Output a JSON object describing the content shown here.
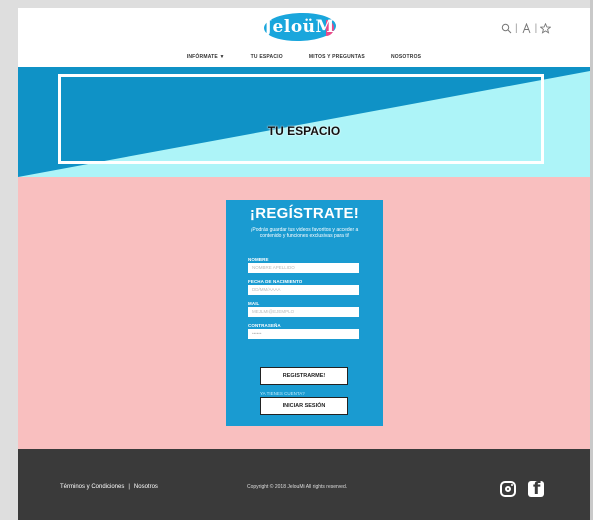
{
  "header": {
    "logo_text": "JeloüMi",
    "icons": [
      "search-icon",
      "user-icon",
      "star-icon"
    ],
    "separator": "|"
  },
  "nav": {
    "items": [
      {
        "label": "INFÓRMATE ▼"
      },
      {
        "label": "TU ESPACIO"
      },
      {
        "label": "MITOS Y PREGUNTAS"
      },
      {
        "label": "NOSOTROS"
      }
    ]
  },
  "banner": {
    "title": "TU ESPACIO",
    "colors": {
      "dark": "#0f92c6",
      "light": "#adf4f8"
    }
  },
  "form": {
    "title": "¡REGÍSTRATE!",
    "subtitle": "¡Podrás guardar tus videos favoritos y acceder a contenido y funciones exclusivas para ti!",
    "fields": [
      {
        "label": "NOMBRE",
        "placeholder": "NOMBRE APELLIDO"
      },
      {
        "label": "FECHA DE NACIMIENTO",
        "placeholder": "DD/MM/AAAA"
      },
      {
        "label": "MAIL",
        "placeholder": "MEJLMI@EJEMPLO"
      },
      {
        "label": "CONTRASEÑA",
        "placeholder": "••••••"
      }
    ],
    "register_label": "REGISTRARME!",
    "have_account": "YA TIENES CUENTA?",
    "login_label": "INICIAR SESIÓN",
    "colors": {
      "card": "#1a9bd1",
      "background": "#f9bfbf"
    }
  },
  "footer": {
    "terms": "Términos y Condiciones",
    "separator": "|",
    "about": "Nosotros",
    "copyright": "Copyright © 2018 JelouMi All rights reserved.",
    "social": [
      "instagram-icon",
      "facebook-icon"
    ]
  }
}
